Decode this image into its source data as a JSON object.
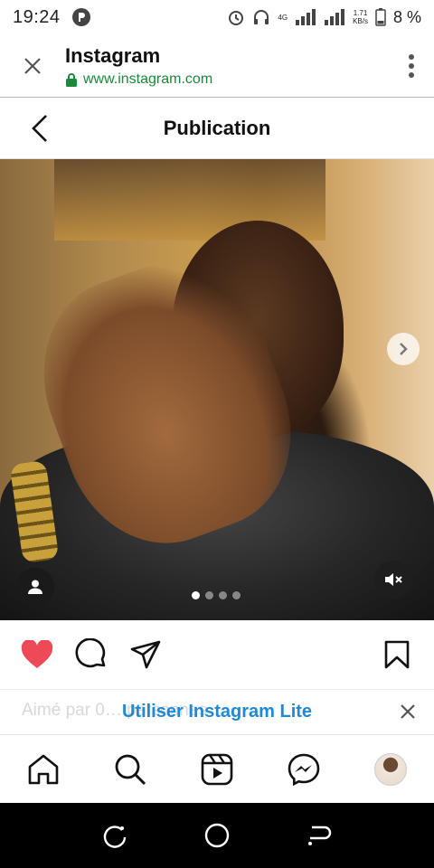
{
  "status_bar": {
    "time": "19:24",
    "network": "4G",
    "speed_value": "1.71",
    "speed_unit": "KB/s",
    "battery": "8 %"
  },
  "browser": {
    "title": "Instagram",
    "url": "www.instagram.com"
  },
  "ig_header": {
    "title": "Publication"
  },
  "media": {
    "carousel_total": 4,
    "carousel_active": 0
  },
  "banner": {
    "background_text": "Aimé par 0… personnes",
    "cta": "Utiliser Instagram Lite"
  },
  "tabbar": {
    "items": [
      "home",
      "search",
      "reels",
      "messenger",
      "profile"
    ]
  },
  "colors": {
    "link_green": "#1a8a3a",
    "cta_blue": "#1e88d9",
    "like_red": "#ed4956"
  },
  "icons": [
    "close-icon",
    "lock-icon",
    "more-vert-icon",
    "back-icon",
    "chevron-right-icon",
    "user-tag-icon",
    "mute-icon",
    "heart-icon",
    "comment-icon",
    "share-icon",
    "bookmark-icon",
    "home-icon",
    "search-icon",
    "reels-icon",
    "messenger-icon"
  ]
}
